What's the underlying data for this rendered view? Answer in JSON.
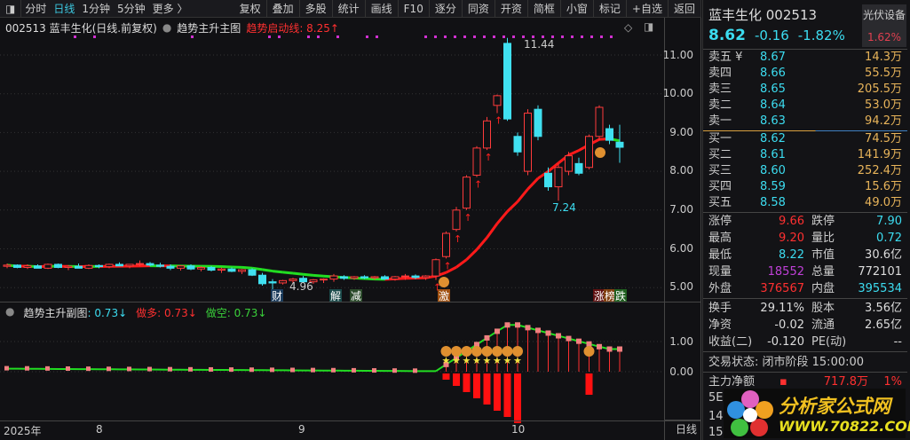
{
  "toolbar": {
    "left_items": [
      "分时",
      "日线",
      "1分钟",
      "5分钟",
      "更多 〉"
    ],
    "right_items": [
      "复权",
      "叠加",
      "多股",
      "统计",
      "画线",
      "F10",
      "逐分",
      "同资",
      "开资",
      "简框",
      "小窗",
      "标记",
      "+自选",
      "返回"
    ]
  },
  "info": {
    "title": "002513 蓝丰生化(日线.前复权)",
    "indicator": "趋势主升主图",
    "trend_line": "趋势启动线: 8.25↑"
  },
  "main_chart": {
    "high_label": "11.44",
    "low_label": "7.24",
    "low2_label": "4.96",
    "tags": [
      "财",
      "解",
      "减",
      "激",
      "涨",
      "榜",
      "跌"
    ],
    "yticks": [
      "11.00",
      "10.00",
      "9.00",
      "8.00",
      "7.00",
      "6.00",
      "5.00"
    ],
    "candles": [
      [
        5.55,
        5.62,
        5.5,
        5.58
      ],
      [
        5.58,
        5.6,
        5.5,
        5.52
      ],
      [
        5.52,
        5.6,
        5.48,
        5.56
      ],
      [
        5.56,
        5.6,
        5.5,
        5.5
      ],
      [
        5.5,
        5.62,
        5.48,
        5.6
      ],
      [
        5.6,
        5.62,
        5.5,
        5.52
      ],
      [
        5.52,
        5.58,
        5.45,
        5.55
      ],
      [
        5.55,
        5.62,
        5.5,
        5.5
      ],
      [
        5.5,
        5.6,
        5.48,
        5.57
      ],
      [
        5.57,
        5.6,
        5.5,
        5.54
      ],
      [
        5.54,
        5.62,
        5.5,
        5.6
      ],
      [
        5.6,
        5.65,
        5.55,
        5.56
      ],
      [
        5.56,
        5.6,
        5.5,
        5.6
      ],
      [
        5.6,
        5.7,
        5.55,
        5.62
      ],
      [
        5.62,
        5.66,
        5.55,
        5.58
      ],
      [
        5.58,
        5.64,
        5.52,
        5.55
      ],
      [
        5.55,
        5.6,
        5.45,
        5.5
      ],
      [
        5.5,
        5.58,
        5.44,
        5.56
      ],
      [
        5.56,
        5.6,
        5.45,
        5.48
      ],
      [
        5.48,
        5.55,
        5.42,
        5.52
      ],
      [
        5.52,
        5.56,
        5.42,
        5.45
      ],
      [
        5.45,
        5.52,
        5.38,
        5.48
      ],
      [
        5.48,
        5.52,
        5.4,
        5.42
      ],
      [
        5.42,
        5.48,
        5.35,
        5.46
      ],
      [
        5.46,
        5.5,
        5.3,
        5.32
      ],
      [
        5.32,
        5.38,
        5.05,
        5.1
      ],
      [
        5.15,
        5.22,
        4.96,
        5.12
      ],
      [
        5.12,
        5.2,
        5.08,
        5.18
      ],
      [
        5.18,
        5.25,
        5.12,
        5.22
      ],
      [
        5.24,
        5.3,
        5.12,
        5.15
      ],
      [
        5.15,
        5.22,
        5.1,
        5.2
      ],
      [
        5.2,
        5.24,
        5.12,
        5.22
      ],
      [
        5.22,
        5.35,
        5.15,
        5.3
      ],
      [
        5.28,
        5.32,
        5.2,
        5.24
      ],
      [
        5.24,
        5.3,
        5.2,
        5.28
      ],
      [
        5.28,
        5.32,
        5.22,
        5.25
      ],
      [
        5.25,
        5.3,
        5.2,
        5.28
      ],
      [
        5.28,
        5.32,
        5.2,
        5.22
      ],
      [
        5.22,
        5.3,
        5.18,
        5.28
      ],
      [
        5.28,
        5.35,
        5.2,
        5.3
      ],
      [
        5.3,
        5.34,
        5.22,
        5.26
      ],
      [
        5.26,
        5.32,
        5.2,
        5.3
      ],
      [
        5.3,
        5.75,
        5.2,
        5.72
      ],
      [
        5.8,
        6.45,
        5.75,
        6.4
      ],
      [
        6.5,
        7.08,
        6.45,
        7.0
      ],
      [
        7.05,
        7.9,
        7.0,
        7.85
      ],
      [
        7.9,
        8.65,
        7.85,
        8.6
      ],
      [
        8.6,
        9.4,
        8.55,
        9.3
      ],
      [
        9.7,
        9.98,
        9.5,
        9.95
      ],
      [
        11.3,
        11.44,
        9.3,
        9.35
      ],
      [
        8.9,
        9.0,
        8.4,
        8.5
      ],
      [
        8.0,
        9.6,
        7.9,
        9.5
      ],
      [
        9.6,
        9.7,
        8.8,
        8.9
      ],
      [
        7.95,
        8.1,
        7.5,
        7.6
      ],
      [
        7.6,
        8.2,
        7.24,
        8.1
      ],
      [
        8.0,
        8.5,
        7.9,
        8.4
      ],
      [
        8.2,
        8.35,
        7.9,
        7.95
      ],
      [
        8.1,
        8.95,
        8.05,
        8.9
      ],
      [
        8.9,
        9.7,
        8.8,
        9.65
      ],
      [
        9.1,
        9.2,
        8.7,
        8.8
      ],
      [
        8.75,
        9.2,
        8.22,
        8.62
      ]
    ]
  },
  "sub_chart": {
    "title": "趋势主升副图",
    "value": ": 0.73↓",
    "long_label": "做多: 0.73↓",
    "short_label": "做空: 0.73↓",
    "yticks": [
      "1.00",
      "0.00"
    ]
  },
  "date_axis": {
    "labels": [
      "2025年",
      "8",
      "9",
      "10"
    ],
    "period": "日线"
  },
  "quote": {
    "name": "蓝丰生化 002513",
    "price": "8.62",
    "change": "-0.16",
    "pct": "-1.82%",
    "sector": "光伏设备",
    "sector_pct": "1.62%"
  },
  "asks": [
    [
      "卖五 ¥",
      "8.67",
      "14.3万"
    ],
    [
      "卖四",
      "8.66",
      "55.5万"
    ],
    [
      "卖三",
      "8.65",
      "205.5万"
    ],
    [
      "卖二",
      "8.64",
      "53.0万"
    ],
    [
      "卖一",
      "8.63",
      "94.2万"
    ]
  ],
  "bids": [
    [
      "买一",
      "8.62",
      "74.5万"
    ],
    [
      "买二",
      "8.61",
      "141.9万"
    ],
    [
      "买三",
      "8.60",
      "252.4万"
    ],
    [
      "买四",
      "8.59",
      "15.6万"
    ],
    [
      "买五",
      "8.58",
      "49.0万"
    ]
  ],
  "stats": [
    [
      "涨停",
      "9.66",
      "跌停",
      "7.90"
    ],
    [
      "最高",
      "9.20",
      "量比",
      "0.72"
    ],
    [
      "最低",
      "8.22",
      "市值",
      "30.6亿"
    ],
    [
      "现量",
      "18552",
      "总量",
      "772101"
    ],
    [
      "外盘",
      "376567",
      "内盘",
      "395534"
    ]
  ],
  "stats2": [
    [
      "换手",
      "29.11%",
      "股本",
      "3.56亿"
    ],
    [
      "净资",
      "-0.02",
      "流通",
      "2.65亿"
    ],
    [
      "收益(二)",
      "-0.120",
      "PE(动)",
      "--"
    ]
  ],
  "trade_status": "交易状态: 闭市阶段 15:00:00",
  "main_flow": {
    "label": "主力净额",
    "value": "717.8万",
    "pct": "1%"
  },
  "partial": [
    "5E",
    "14:",
    "15:"
  ],
  "watermark": {
    "title": "分析家公式网",
    "url": "WWW.70822.COM"
  }
}
